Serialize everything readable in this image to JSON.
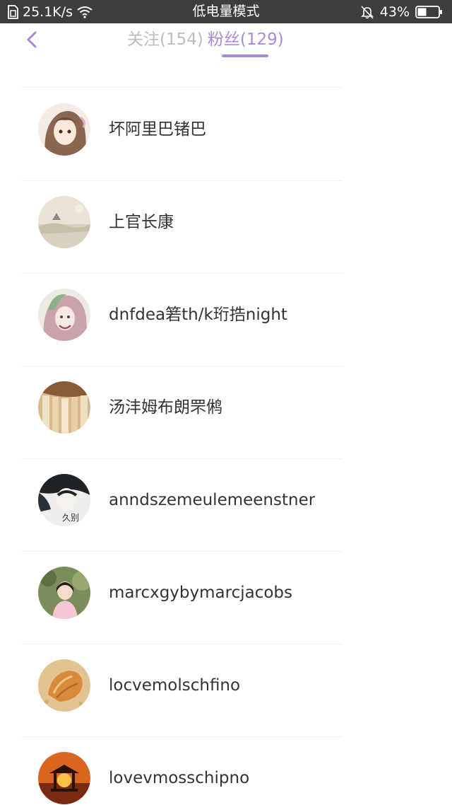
{
  "status_bar": {
    "network_speed": "25.1K/s",
    "mode_label": "低电量模式",
    "battery_percent": "43%",
    "battery_level": 0.43,
    "icons": [
      "sim-icon",
      "wifi-icon",
      "bell-off-icon",
      "battery-icon"
    ]
  },
  "header": {
    "tabs": [
      {
        "label": "关注(154)",
        "active": false
      },
      {
        "label": "粉丝(129)",
        "active": true
      }
    ]
  },
  "colors": {
    "accent": "#a98ad6",
    "status_bar_bg": "#3d3d3d",
    "inactive_tab": "#bdbdbd",
    "name_text": "#333333",
    "divider": "#f1f1f1"
  },
  "followers": [
    {
      "name": "坏阿里巴锗巴",
      "avatar": "anime-girl-avatar"
    },
    {
      "name": "上官长康",
      "avatar": "misty-landscape-avatar"
    },
    {
      "name": "dnfdea箬th/k珩捁night",
      "avatar": "pink-anime-avatar"
    },
    {
      "name": "汤沣姆布朗罘鸺",
      "avatar": "curtain-photo-avatar"
    },
    {
      "name": "anndszemeulemeenstner",
      "avatar": "dark-hair-portrait-avatar",
      "avatar_text": "久别"
    },
    {
      "name": "marcxgybymarcjacobs",
      "avatar": "little-girl-avatar"
    },
    {
      "name": "locvemolschfino",
      "avatar": "seashell-avatar"
    },
    {
      "name": "lovevmosschipno",
      "avatar": "sunset-pavilion-avatar"
    }
  ]
}
